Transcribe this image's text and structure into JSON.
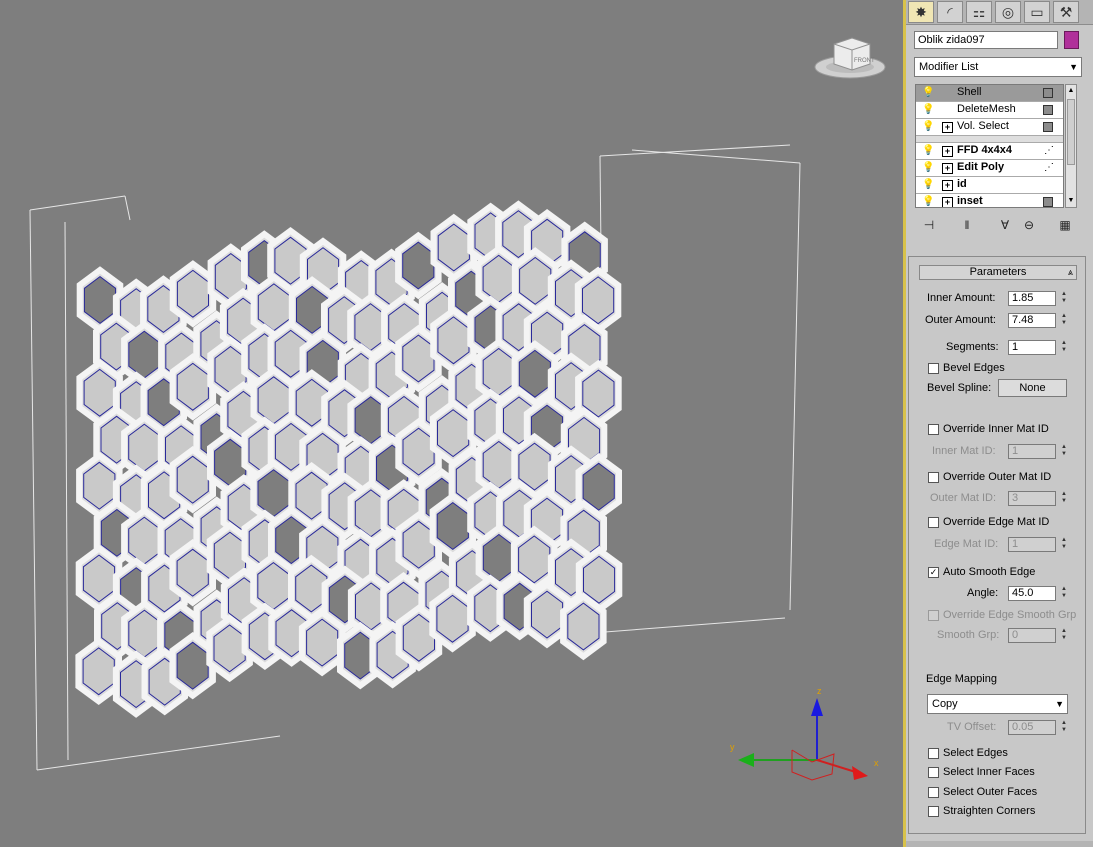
{
  "colors": {
    "viewport_bg": "#7e7e7e",
    "panel_bg": "#c8c8c8",
    "object_color": "#b0309a",
    "active_tab": "#f0e6b4"
  },
  "viewcube": {
    "label": "FRONT"
  },
  "gizmo": {
    "x": "x",
    "y": "y",
    "z": "z"
  },
  "command_panel": {
    "tabs": [
      {
        "icon": "create-icon",
        "glyph": "✸"
      },
      {
        "icon": "modify-icon",
        "glyph": "◜"
      },
      {
        "icon": "hierarchy-icon",
        "glyph": "⚏"
      },
      {
        "icon": "motion-icon",
        "glyph": "◎"
      },
      {
        "icon": "display-icon",
        "glyph": "▭"
      },
      {
        "icon": "utilities-icon",
        "glyph": "⚒"
      }
    ],
    "object_name": "Oblik zida097",
    "modifier_list": "Modifier List",
    "stack": [
      {
        "label": "Shell",
        "bold": false,
        "expandable": false,
        "indicator": "box",
        "selected": true
      },
      {
        "label": "DeleteMesh",
        "bold": false,
        "expandable": false,
        "indicator": "box",
        "selected": false
      },
      {
        "label": "Vol. Select",
        "bold": false,
        "expandable": true,
        "indicator": "box",
        "selected": false
      },
      {
        "label": "FFD 4x4x4",
        "bold": true,
        "expandable": true,
        "indicator": "dots",
        "selected": false
      },
      {
        "label": "Edit Poly",
        "bold": true,
        "expandable": true,
        "indicator": "dots",
        "selected": false
      },
      {
        "label": "id",
        "bold": true,
        "expandable": true,
        "indicator": "none",
        "selected": false
      },
      {
        "label": "inset",
        "bold": true,
        "expandable": true,
        "indicator": "box",
        "selected": false
      }
    ],
    "stack_tools": [
      "pin-stack-icon",
      "show-end-result-icon",
      "make-unique-icon",
      "remove-modifier-icon",
      "configure-sets-icon"
    ]
  },
  "parameters": {
    "title": "Parameters",
    "inner_amount": {
      "label": "Inner Amount:",
      "value": "1.85"
    },
    "outer_amount": {
      "label": "Outer Amount:",
      "value": "7.48"
    },
    "segments": {
      "label": "Segments:",
      "value": "1"
    },
    "bevel_edges": {
      "label": "Bevel Edges",
      "checked": false
    },
    "bevel_spline": {
      "label": "Bevel Spline:",
      "button": "None"
    },
    "override_inner": {
      "label": "Override Inner Mat ID",
      "checked": false
    },
    "inner_mat_id": {
      "label": "Inner Mat ID:",
      "value": "1"
    },
    "override_outer": {
      "label": "Override Outer Mat ID",
      "checked": false
    },
    "outer_mat_id": {
      "label": "Outer Mat ID:",
      "value": "3"
    },
    "override_edge": {
      "label": "Override Edge Mat ID",
      "checked": false
    },
    "edge_mat_id": {
      "label": "Edge Mat ID:",
      "value": "1"
    },
    "auto_smooth": {
      "label": "Auto Smooth Edge",
      "checked": true
    },
    "angle": {
      "label": "Angle:",
      "value": "45.0"
    },
    "override_smooth": {
      "label": "Override Edge Smooth Grp",
      "checked": false
    },
    "smooth_grp": {
      "label": "Smooth Grp:",
      "value": "0"
    },
    "edge_mapping": {
      "label": "Edge Mapping",
      "value": "Copy"
    },
    "tv_offset": {
      "label": "TV Offset:",
      "value": "0.05"
    },
    "select_edges": {
      "label": "Select Edges",
      "checked": false
    },
    "select_inner": {
      "label": "Select Inner Faces",
      "checked": false
    },
    "select_outer": {
      "label": "Select Outer Faces",
      "checked": false
    },
    "straighten": {
      "label": "Straighten Corners",
      "checked": false
    }
  }
}
